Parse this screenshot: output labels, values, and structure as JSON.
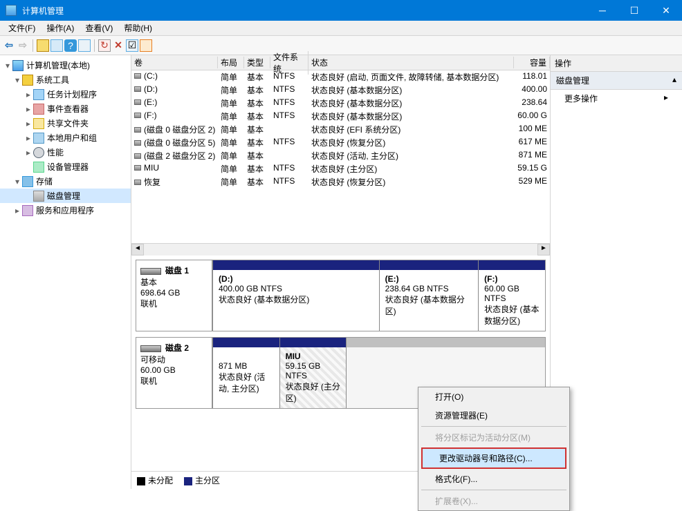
{
  "title": "计算机管理",
  "menubar": [
    "文件(F)",
    "操作(A)",
    "查看(V)",
    "帮助(H)"
  ],
  "tree": {
    "root": "计算机管理(本地)",
    "system_tools": "系统工具",
    "task": "任务计划程序",
    "event": "事件查看器",
    "share": "共享文件夹",
    "users": "本地用户和组",
    "perf": "性能",
    "device": "设备管理器",
    "storage": "存储",
    "diskmgmt": "磁盘管理",
    "services": "服务和应用程序"
  },
  "columns": {
    "vol": "卷",
    "layout": "布局",
    "type": "类型",
    "fs": "文件系统",
    "status": "状态",
    "cap": "容量"
  },
  "volumes": [
    {
      "name": "(C:)",
      "layout": "简单",
      "type": "基本",
      "fs": "NTFS",
      "status": "状态良好 (启动, 页面文件, 故障转储, 基本数据分区)",
      "cap": "118.01"
    },
    {
      "name": "(D:)",
      "layout": "简单",
      "type": "基本",
      "fs": "NTFS",
      "status": "状态良好 (基本数据分区)",
      "cap": "400.00"
    },
    {
      "name": "(E:)",
      "layout": "简单",
      "type": "基本",
      "fs": "NTFS",
      "status": "状态良好 (基本数据分区)",
      "cap": "238.64"
    },
    {
      "name": "(F:)",
      "layout": "简单",
      "type": "基本",
      "fs": "NTFS",
      "status": "状态良好 (基本数据分区)",
      "cap": "60.00 G"
    },
    {
      "name": "(磁盘 0 磁盘分区 2)",
      "layout": "简单",
      "type": "基本",
      "fs": "",
      "status": "状态良好 (EFI 系统分区)",
      "cap": "100 ME"
    },
    {
      "name": "(磁盘 0 磁盘分区 5)",
      "layout": "简单",
      "type": "基本",
      "fs": "NTFS",
      "status": "状态良好 (恢复分区)",
      "cap": "617 ME"
    },
    {
      "name": "(磁盘 2 磁盘分区 2)",
      "layout": "简单",
      "type": "基本",
      "fs": "",
      "status": "状态良好 (活动, 主分区)",
      "cap": "871 ME"
    },
    {
      "name": "MIU",
      "layout": "简单",
      "type": "基本",
      "fs": "NTFS",
      "status": "状态良好 (主分区)",
      "cap": "59.15 G"
    },
    {
      "name": "恢复",
      "layout": "简单",
      "type": "基本",
      "fs": "NTFS",
      "status": "状态良好 (恢复分区)",
      "cap": "529 ME"
    }
  ],
  "disks": {
    "disk1": {
      "name": "磁盘 1",
      "type": "基本",
      "size": "698.64 GB",
      "state": "联机",
      "parts": [
        {
          "label": "(D:)",
          "size": "400.00 GB NTFS",
          "status": "状态良好 (基本数据分区)"
        },
        {
          "label": "(E:)",
          "size": "238.64 GB NTFS",
          "status": "状态良好 (基本数据分区)"
        },
        {
          "label": "(F:)",
          "size": "60.00 GB NTFS",
          "status": "状态良好 (基本数据分区)"
        }
      ]
    },
    "disk2": {
      "name": "磁盘 2",
      "type": "可移动",
      "size": "60.00 GB",
      "state": "联机",
      "parts": [
        {
          "label": "",
          "size": "871 MB",
          "status": "状态良好 (活动, 主分区)"
        },
        {
          "label": "MIU",
          "size": "59.15 GB NTFS",
          "status": "状态良好 (主分区)"
        }
      ]
    }
  },
  "legend": {
    "unalloc": "未分配",
    "primary": "主分区"
  },
  "actions": {
    "header": "操作",
    "section": "磁盘管理",
    "more": "更多操作"
  },
  "context_menu": {
    "open": "打开(O)",
    "explorer": "资源管理器(E)",
    "mark_active": "将分区标记为活动分区(M)",
    "change_letter": "更改驱动器号和路径(C)...",
    "format": "格式化(F)...",
    "extend": "扩展卷(X)..."
  }
}
